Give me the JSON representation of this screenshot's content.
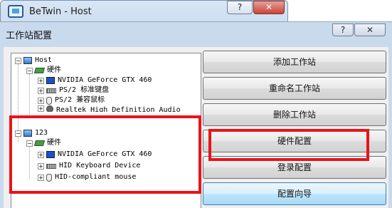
{
  "back_window": {
    "title": "BeTwin - Host",
    "buttons": {
      "help": "?",
      "close": "✕"
    }
  },
  "dialog": {
    "title": "工作站配置",
    "buttons": {
      "help": "?",
      "close": "✕"
    }
  },
  "tree": {
    "host": {
      "label": "Host",
      "hardware_label": "硬件",
      "devices": [
        "NVIDIA GeForce GTX 460",
        "PS/2 标准键盘",
        "PS/2 兼容鼠标",
        "Realtek High Definition Audio"
      ]
    },
    "station": {
      "label": "123",
      "hardware_label": "硬件",
      "devices": [
        "NVIDIA GeForce GTX 460",
        "HID Keyboard Device",
        "HID-compliant mouse"
      ]
    }
  },
  "actions": {
    "add": "添加工作站",
    "rename": "重命名工作站",
    "delete": "删除工作站",
    "hardware": "硬件配置",
    "login": "登录配置",
    "wizard": "配置向导"
  },
  "colors": {
    "highlight": "#e8141a",
    "dialog_bg": "#c9daed"
  }
}
